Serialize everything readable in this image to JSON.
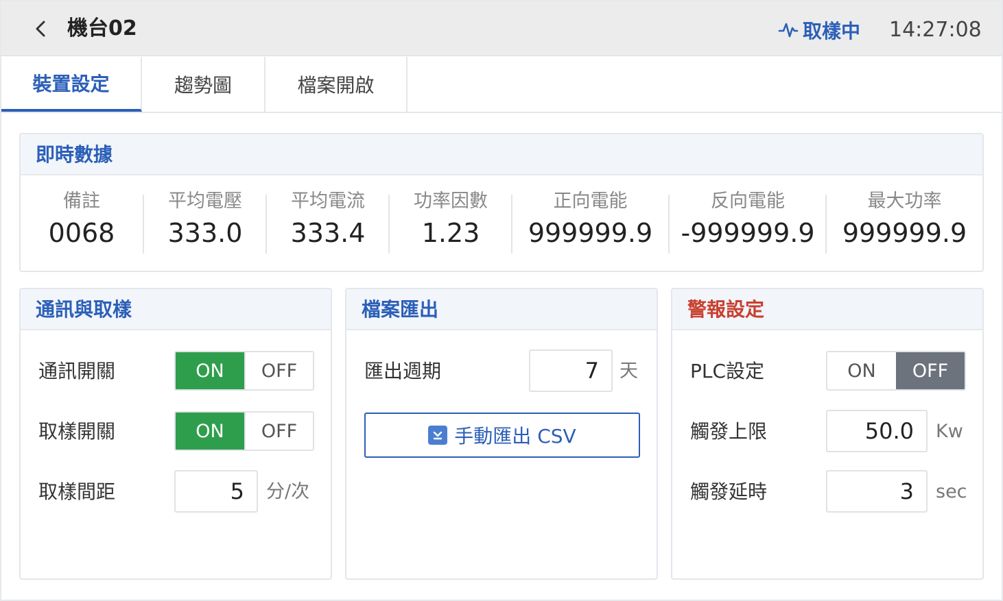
{
  "header": {
    "title": "機台02",
    "status": "取樣中",
    "time": "14:27:08"
  },
  "tabs": [
    {
      "label": "裝置設定",
      "active": true
    },
    {
      "label": "趨勢圖",
      "active": false
    },
    {
      "label": "檔案開啟",
      "active": false
    }
  ],
  "realtime": {
    "title": "即時數據",
    "stats": [
      {
        "label": "備註",
        "value": "0068"
      },
      {
        "label": "平均電壓",
        "value": "333.0"
      },
      {
        "label": "平均電流",
        "value": "333.4"
      },
      {
        "label": "功率因數",
        "value": "1.23"
      },
      {
        "label": "正向電能",
        "value": "999999.9"
      },
      {
        "label": "反向電能",
        "value": "-999999.9"
      },
      {
        "label": "最大功率",
        "value": "999999.9"
      }
    ]
  },
  "comm": {
    "title": "通訊與取樣",
    "comm_switch": {
      "label": "通訊開關",
      "on": "ON",
      "off": "OFF",
      "state": "on"
    },
    "sample_switch": {
      "label": "取樣開關",
      "on": "ON",
      "off": "OFF",
      "state": "on"
    },
    "interval": {
      "label": "取樣間距",
      "value": "5",
      "unit": "分/次"
    }
  },
  "export": {
    "title": "檔案匯出",
    "period": {
      "label": "匯出週期",
      "value": "7",
      "unit": "天"
    },
    "manual_button": "手動匯出 CSV"
  },
  "alarm": {
    "title": "警報設定",
    "plc": {
      "label": "PLC設定",
      "on": "ON",
      "off": "OFF",
      "state": "off"
    },
    "upper": {
      "label": "觸發上限",
      "value": "50.0",
      "unit": "Kw"
    },
    "delay": {
      "label": "觸發延時",
      "value": "3",
      "unit": "sec"
    }
  },
  "colors": {
    "accent": "#2b5fb8",
    "on_green": "#2e9e4c",
    "off_gray": "#6c737d",
    "alarm_red": "#c8402f"
  }
}
